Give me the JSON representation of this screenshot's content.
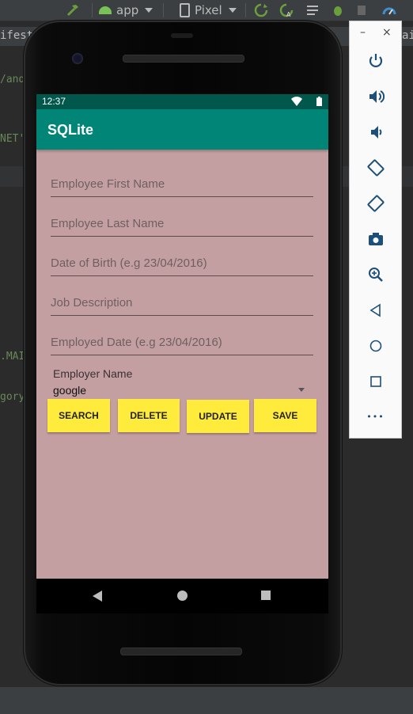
{
  "ide": {
    "run_config": "app",
    "device": "Pixel",
    "tab_partial": "ifest.x",
    "tab_partial_right": "ai",
    "code_fragments": [
      "/and",
      "NET'",
      ".MAI",
      "gory"
    ]
  },
  "emulator_panel": {
    "minimize": "–",
    "close": "×",
    "more": "•••",
    "tools": [
      "power-icon",
      "volume-up-icon",
      "volume-down-icon",
      "rotate-left-icon",
      "rotate-right-icon",
      "camera-icon",
      "zoom-icon",
      "back-icon",
      "home-icon",
      "overview-icon",
      "more-icon"
    ]
  },
  "status_bar": {
    "time": "12:37"
  },
  "app": {
    "title": "SQLite",
    "fields": [
      {
        "placeholder": "Employee First Name"
      },
      {
        "placeholder": "Employee Last Name"
      },
      {
        "placeholder": "Date of Birth (e.g 23/04/2016)"
      },
      {
        "placeholder": "Job Description"
      },
      {
        "placeholder": "Employed Date (e.g 23/04/2016)"
      }
    ],
    "employer_label": "Employer Name",
    "employer_value": "google",
    "buttons": {
      "search": "SEARCH",
      "delete": "DELETE",
      "update": "UPDATE",
      "save": "SAVE"
    }
  },
  "colors": {
    "status_bar": "#00574b",
    "app_bar": "#008577",
    "screen_bg": "#c49fa2",
    "button_bg": "#ffeb3b"
  }
}
